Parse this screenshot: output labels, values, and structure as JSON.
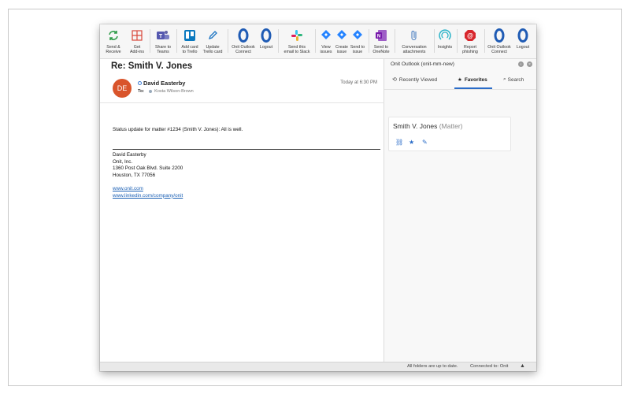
{
  "ribbon": {
    "items": [
      {
        "label": "Send &\nReceive",
        "icon": "send-receive-icon"
      },
      {
        "label": "Get\nAdd-ins",
        "icon": "add-ins-icon"
      },
      {
        "label": "Share to\nTeams",
        "icon": "teams-icon"
      },
      {
        "label": "Add card\nto Trello",
        "icon": "trello-icon"
      },
      {
        "label": "Update\nTrello card",
        "icon": "pencil-icon"
      },
      {
        "label": "Onit Outlook\nConnect",
        "icon": "onit-icon"
      },
      {
        "label": "Logout",
        "icon": "onit-logout-icon"
      },
      {
        "label": "Send this\nemail to Slack",
        "icon": "slack-icon"
      },
      {
        "label": "View\nissues",
        "icon": "jira-view-icon"
      },
      {
        "label": "Create\nissue",
        "icon": "jira-create-icon"
      },
      {
        "label": "Send to\nissue",
        "icon": "jira-send-icon"
      },
      {
        "label": "Send to\nOneNote",
        "icon": "onenote-icon"
      },
      {
        "label": "Conversation\nattachments",
        "icon": "paperclip-icon"
      },
      {
        "label": "Insights",
        "icon": "insights-icon"
      },
      {
        "label": "Report\nphishing",
        "icon": "phishing-icon"
      },
      {
        "label": "Onit Outlook\nConnect",
        "icon": "onit-icon"
      },
      {
        "label": "Logout",
        "icon": "onit-logout-icon"
      }
    ]
  },
  "email": {
    "subject": "Re: Smith V. Jones",
    "avatar_initials": "DE",
    "sender": "David Easterby",
    "time": "Today at 6:30 PM",
    "to_label": "To:",
    "to_name": "Kosta Wilson-Brown",
    "body": "Status update for matter #1234 (Smith V. Jones):  All is well.",
    "signature": {
      "name": "David Easterby",
      "company": "Onit, Inc.",
      "address1": "1360 Post Oak Blvd. Suite 2200",
      "address2": "Houston, TX 77056",
      "link1": "www.onit.com",
      "link2": "www.linkedin.com/company/onit"
    }
  },
  "pane": {
    "title": "Onit Outlook (onit-mm-new)",
    "tabs": {
      "recent": "Recently Viewed",
      "favorites": "Favorites",
      "search": "Search"
    },
    "card": {
      "name": "Smith V. Jones",
      "type": "(Matter)"
    }
  },
  "status": {
    "sync": "All folders are up to date.",
    "connection": "Connected to: Onit"
  },
  "colors": {
    "accent": "#2a6cc8",
    "avatar": "#d9542b",
    "onit": "#1f5bb4"
  }
}
